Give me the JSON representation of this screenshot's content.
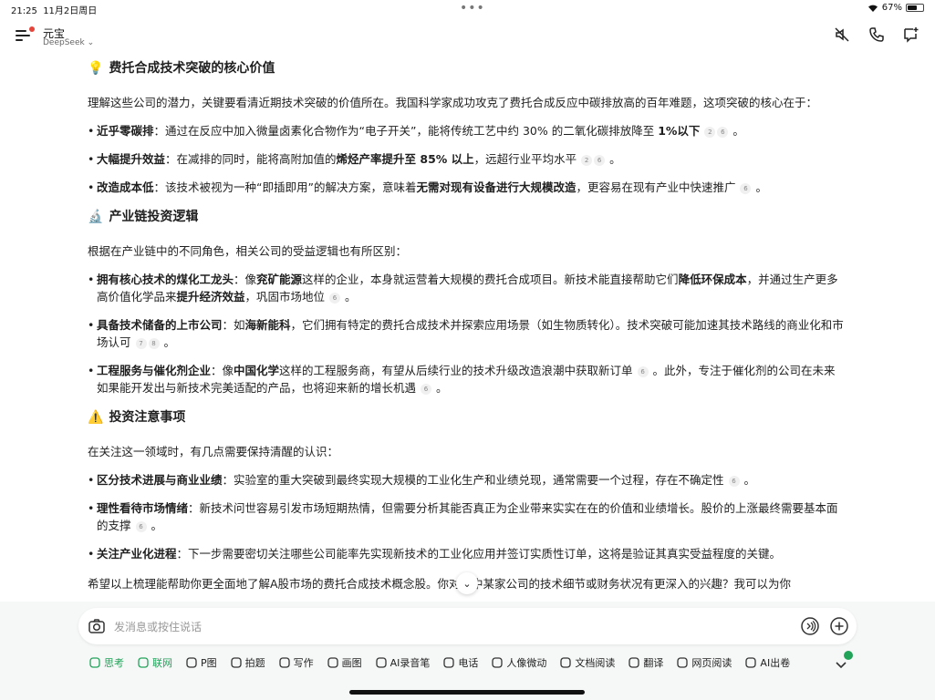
{
  "status": {
    "time": "21:25",
    "date": "11月2日周日",
    "battery": "67%",
    "battery_level": 0.67
  },
  "header": {
    "title": "元宝",
    "subtitle": "DeepSeek",
    "subtitle_chevron": "⌄"
  },
  "content": {
    "s1_title": "费托合成技术突破的核心价值",
    "s1_intro": "理解这些公司的潜力，关键要看清近期技术突破的价值所在。我国科学家成功攻克了费托合成反应中碳排放高的百年难题，这项突破的核心在于：",
    "b1": {
      "k": "近乎零碳排",
      "t1": "：通过在反应中加入微量卤素化合物作为“电子开关”，能将传统工艺中约 30% 的二氧化碳排放降至 ",
      "bold": "1%以下",
      "c1": "2",
      "c2": "6",
      "end": "。"
    },
    "b2": {
      "k": "大幅提升效益",
      "t1": "：在减排的同时，能将高附加值的",
      "bold": "烯烃产率提升至 85% 以上",
      "t2": "，远超行业平均水平",
      "c1": "2",
      "c2": "6",
      "end": "。"
    },
    "b3": {
      "k": "改造成本低",
      "t1": "：该技术被视为一种“即插即用”的解决方案，意味着",
      "bold": "无需对现有设备进行大规模改造",
      "t2": "，更容易在现有产业中快速推广",
      "c1": "6",
      "end": "。"
    },
    "s2_title": "产业链投资逻辑",
    "s2_intro": "根据在产业链中的不同角色，相关公司的受益逻辑也有所区别：",
    "b4": {
      "k": "拥有核心技术的煤化工龙头",
      "t1": "：像",
      "n1": "兖矿能源",
      "t2": "这样的企业，本身就运营着大规模的费托合成项目。新技术能直接帮助它们",
      "bold1": "降低环保成本",
      "t3": "，并通过生产更多高价值化学品来",
      "bold2": "提升经济效益",
      "t4": "，巩固市场地位",
      "c1": "6",
      "end": "。"
    },
    "b5": {
      "k": "具备技术储备的上市公司",
      "t1": "：如",
      "n1": "海新能科",
      "t2": "，它们拥有特定的费托合成技术并探索应用场景（如生物质转化）。技术突破可能加速其技术路线的商业化和市场认可",
      "c1": "7",
      "c2": "8",
      "end": "。"
    },
    "b6": {
      "k": "工程服务与催化剂企业",
      "t1": "：像",
      "n1": "中国化学",
      "t2": "这样的工程服务商，有望从后续行业的技术升级改造浪潮中获取新订单",
      "c1": "6",
      "t3": "。此外，专注于催化剂的公司在未来如果能开发出与新技术完美适配的产品，也将迎来新的增长机遇",
      "c2": "6",
      "end": "。"
    },
    "s3_title": "投资注意事项",
    "s3_intro": "在关注这一领域时，有几点需要保持清醒的认识：",
    "b7": {
      "k": "区分技术进展与商业业绩",
      "t1": "：实验室的重大突破到最终实现大规模的工业化生产和业绩兑现，通常需要一个过程，存在不确定性",
      "c1": "6",
      "end": "。"
    },
    "b8": {
      "k": "理性看待市场情绪",
      "t1": "：新技术问世容易引发市场短期热情，但需要分析其能否真正为企业带来实实在在的价值和业绩增长。股价的上涨最终需要基本面的支撑",
      "c1": "6",
      "end": "。"
    },
    "b9": {
      "k": "关注产业化进程",
      "t1": "：下一步需要密切关注哪些公司能率先实现新技术的工业化应用并签订实质性订单，这将是验证其真实受益程度的关键。"
    },
    "closing": "希望以上梳理能帮助你更全面地了解A股市场的费托合成技术概念股。你对其中某家公司的技术细节或财务状况有更深入的兴趣？我可以为你"
  },
  "input": {
    "placeholder": "发消息或按住说话"
  },
  "toolbar": [
    {
      "label": "思考",
      "active": true
    },
    {
      "label": "联网",
      "active": true
    },
    {
      "label": "P图",
      "active": false
    },
    {
      "label": "拍题",
      "active": false
    },
    {
      "label": "写作",
      "active": false
    },
    {
      "label": "画图",
      "active": false
    },
    {
      "label": "AI录音笔",
      "active": false
    },
    {
      "label": "电话",
      "active": false
    },
    {
      "label": "人像微动",
      "active": false
    },
    {
      "label": "文档阅读",
      "active": false
    },
    {
      "label": "翻译",
      "active": false
    },
    {
      "label": "网页阅读",
      "active": false
    },
    {
      "label": "AI出卷",
      "active": false
    }
  ],
  "colors": {
    "accent": "#22a35a",
    "notify": "#e5443b"
  }
}
